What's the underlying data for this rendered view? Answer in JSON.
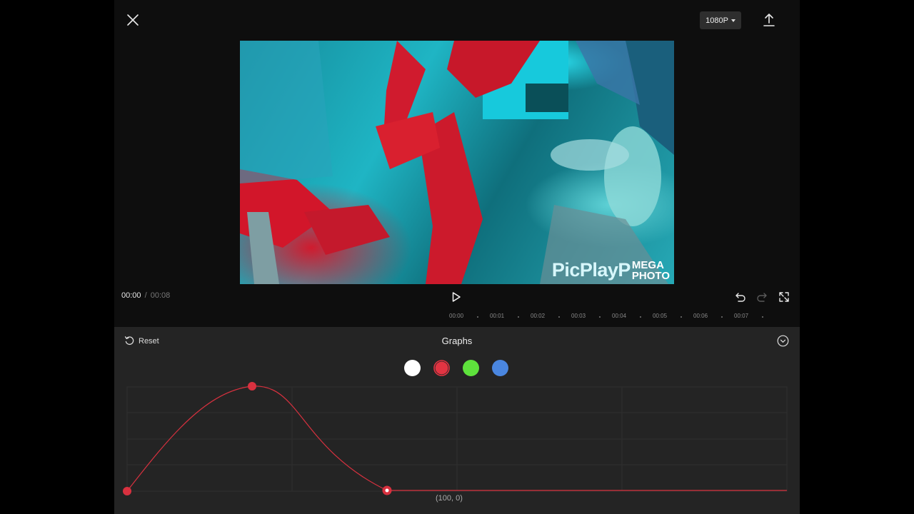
{
  "header": {
    "resolution": "1080P",
    "icons": [
      "close-icon",
      "export-icon"
    ]
  },
  "preview": {
    "watermark_text": "PicPlayP",
    "watermark_badge_line1": "MEGA",
    "watermark_badge_line2": "PHOTO"
  },
  "playback": {
    "current_time": "00:00",
    "separator": "/",
    "total_time": "00:08",
    "icons": [
      "play-icon",
      "undo-icon",
      "redo-icon",
      "fullscreen-icon"
    ]
  },
  "timeline": {
    "ticks": [
      "00:00",
      "00:01",
      "00:02",
      "00:03",
      "00:04",
      "00:05",
      "00:06",
      "00:07"
    ]
  },
  "graphs_panel": {
    "reset_label": "Reset",
    "title": "Graphs",
    "selected_channel": "red",
    "channels": [
      {
        "name": "white",
        "color": "#ffffff"
      },
      {
        "name": "red",
        "color": "#e23442"
      },
      {
        "name": "green",
        "color": "#5ee23c"
      },
      {
        "name": "blue",
        "color": "#4a86e0"
      }
    ],
    "curve_color": "#d8313f",
    "selected_point_label": "(100, 0)"
  }
}
